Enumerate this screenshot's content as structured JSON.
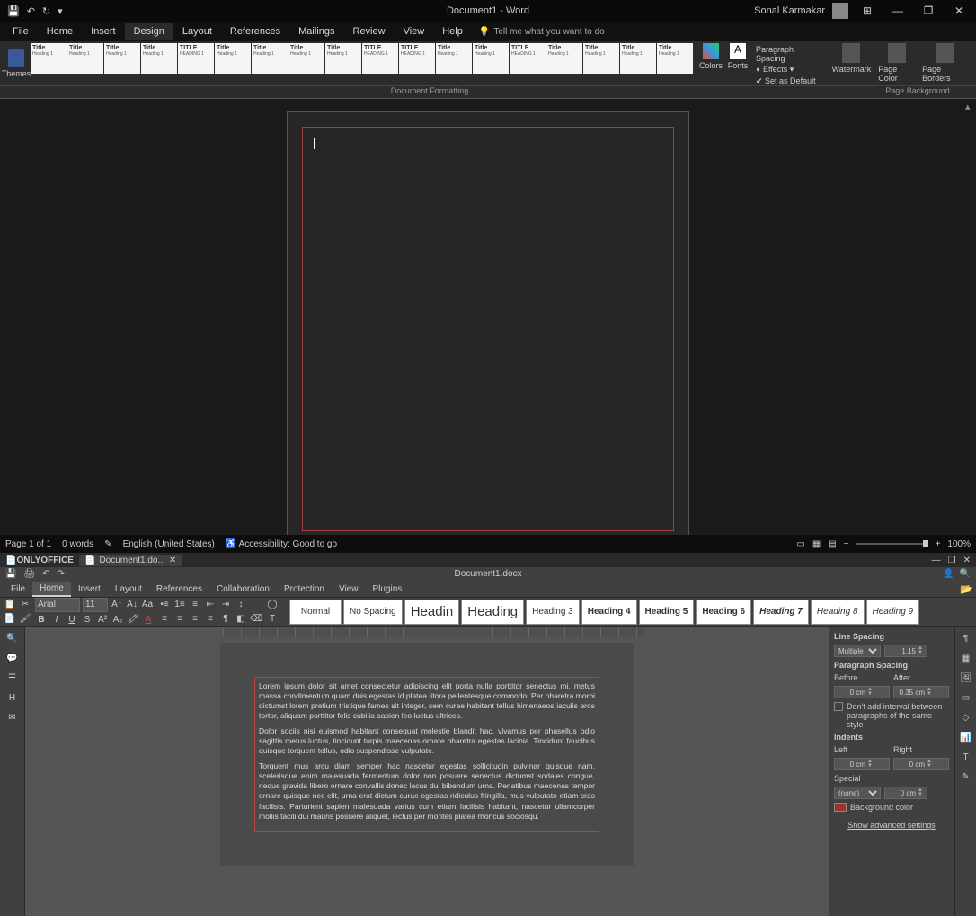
{
  "word": {
    "title": "Document1  -  Word",
    "user": "Sonal Karmakar",
    "menus": [
      "File",
      "Home",
      "Insert",
      "Design",
      "Layout",
      "References",
      "Mailings",
      "Review",
      "View",
      "Help"
    ],
    "active_menu": "Design",
    "tellme": "Tell me what you want to do",
    "themes_label": "Themes",
    "gallery_labels": [
      "Title",
      "Title",
      "Title",
      "Title",
      "TITLE",
      "Title",
      "Title",
      "Title",
      "Title",
      "TITLE",
      "TITLE",
      "Title",
      "Title",
      "TITLE",
      "Title",
      "Title",
      "Title",
      "Title"
    ],
    "colors_label": "Colors",
    "fonts_label": "Fonts",
    "para_spacing": "Paragraph Spacing",
    "effects": "Effects",
    "set_default": "Set as Default",
    "watermark": "Watermark",
    "page_color": "Page Color",
    "page_borders": "Page Borders",
    "doc_formatting": "Document Formatting",
    "page_background": "Page Background",
    "status": {
      "page": "Page 1 of 1",
      "words": "0 words",
      "lang": "English (United States)",
      "a11y": "Accessibility: Good to go",
      "zoom": "100%"
    }
  },
  "oo": {
    "brand": "ONLYOFFICE",
    "tab_name": "Document1.do...",
    "doc_title": "Document1.docx",
    "menus": [
      "File",
      "Home",
      "Insert",
      "Layout",
      "References",
      "Collaboration",
      "Protection",
      "View",
      "Plugins"
    ],
    "active_menu": "Home",
    "font": "Arial",
    "font_size": "11",
    "styles": [
      {
        "label": "Normal",
        "cls": ""
      },
      {
        "label": "No Spacing",
        "cls": ""
      },
      {
        "label": "Headin",
        "cls": "big"
      },
      {
        "label": "Heading",
        "cls": "big"
      },
      {
        "label": "Heading 3",
        "cls": ""
      },
      {
        "label": "Heading 4",
        "cls": "bold"
      },
      {
        "label": "Heading 5",
        "cls": "bold"
      },
      {
        "label": "Heading 6",
        "cls": "bold"
      },
      {
        "label": "Heading 7",
        "cls": "bold italic"
      },
      {
        "label": "Heading 8",
        "cls": "italic"
      },
      {
        "label": "Heading 9",
        "cls": "italic"
      }
    ],
    "paragraphs": [
      "Lorem ipsum dolor sit amet consectetur adipiscing elit porta nulla porttitor senectus mi, metus massa condimentum quam duis egestas id platea litora pellentesque commodo. Per pharetra morbi dictumst lorem pretium tristique fames sit integer, sem curae habitant tellus himenaeos iaculis eros tortor, aliquam porttitor felis cubilia sapien leo luctus ultrices.",
      "Dolor sociis nisi euismod habitant consequat molestie blandit hac, vivamus per phasellus odio sagittis metus luctus, tincidunt turpis maecenas ornare pharetra egestas lacinia. Tincidunt faucibus quisque torquent tellus, odio suspendisse vulputate.",
      "Torquent mus arcu diam semper hac nascetur egestas sollicitudin pulvinar quisque nam, scelerisque enim malesuada fermentum dolor non posuere senectus dictumst sodales congue, neque gravida libero ornare convallis donec lacus dui bibendum urna. Penatibus maecenas tempor ornare quisque nec elit, urna erat dictum curae egestas ridiculus fringilla, mus vulputate etiam cras facilisis. Parturient sapien malesuada varius cum etiam facilisis habitant, nascetur ullamcorper mollis taciti dui mauris posuere aliquet, lectus per montes platea rhoncus sociosqu."
    ],
    "props": {
      "line_spacing": "Line Spacing",
      "ls_mode": "Multiple",
      "ls_val": "1.15",
      "para_spacing": "Paragraph Spacing",
      "before": "Before",
      "after": "After",
      "before_val": "0 cm",
      "after_val": "0.35 cm",
      "no_interval": "Don't add interval between paragraphs of the same style",
      "indents": "Indents",
      "left": "Left",
      "right": "Right",
      "left_val": "0 cm",
      "right_val": "0 cm",
      "special": "Special",
      "special_mode": "(none)",
      "special_val": "0 cm",
      "bg_color": "Background color",
      "advanced": "Show advanced settings"
    }
  }
}
